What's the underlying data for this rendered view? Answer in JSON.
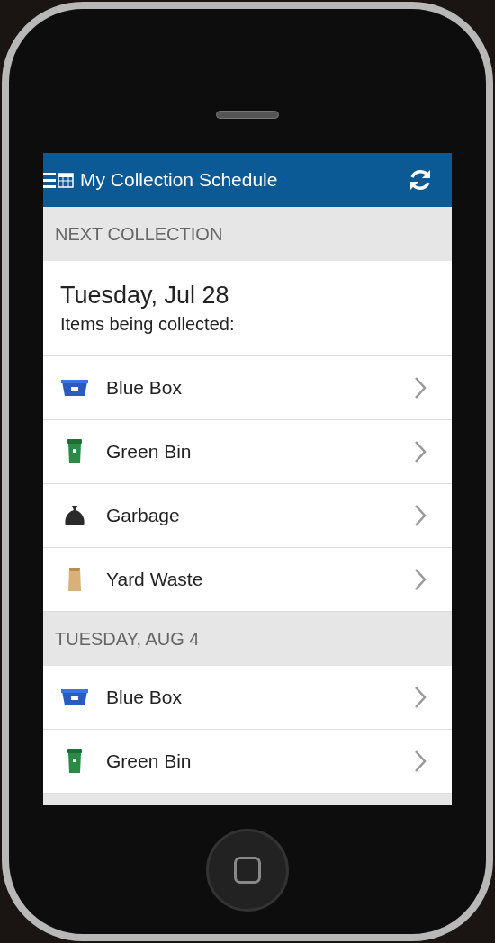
{
  "header": {
    "title": "My Collection Schedule"
  },
  "sections": [
    {
      "heading": "NEXT COLLECTION",
      "date": "Tuesday, Jul 28",
      "subtitle": "Items being collected:",
      "items": [
        {
          "kind": "bluebox",
          "label": "Blue Box"
        },
        {
          "kind": "greenbin",
          "label": "Green Bin"
        },
        {
          "kind": "garbage",
          "label": "Garbage"
        },
        {
          "kind": "yard",
          "label": "Yard Waste"
        }
      ]
    },
    {
      "heading": "TUESDAY, AUG 4",
      "items": [
        {
          "kind": "bluebox",
          "label": "Blue Box"
        },
        {
          "kind": "greenbin",
          "label": "Green Bin"
        }
      ]
    }
  ]
}
